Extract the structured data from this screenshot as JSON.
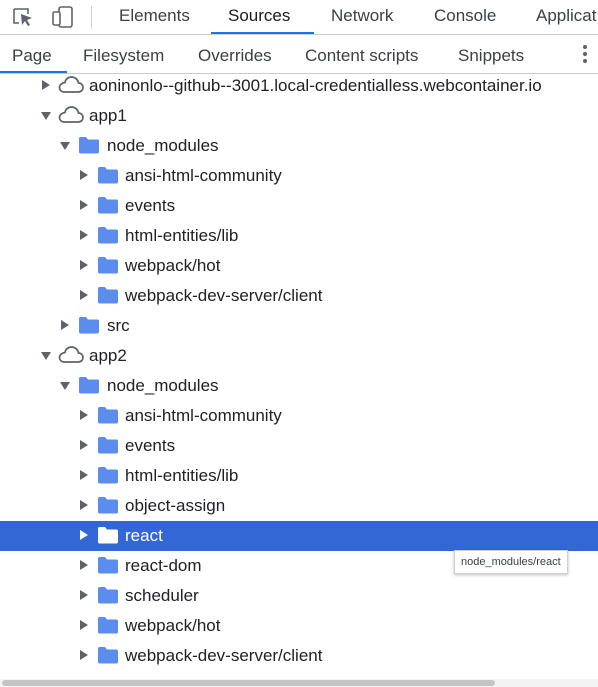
{
  "toolbar": {
    "inspect_icon": "inspect-element-icon",
    "device_icon": "device-toolbar-icon",
    "tabs": [
      "Elements",
      "Sources",
      "Network",
      "Console",
      "Applicat"
    ],
    "active_tab": "Sources"
  },
  "subtabs": {
    "items": [
      "Page",
      "Filesystem",
      "Overrides",
      "Content scripts",
      "Snippets"
    ],
    "active": "Page",
    "more_icon": "more-options-icon"
  },
  "tree": [
    {
      "label": "aoninonlo--github--3001.local-credentialless.webcontainer.io",
      "kind": "cloud",
      "expanded": false
    },
    {
      "label": "app1",
      "kind": "cloud",
      "expanded": true
    },
    {
      "label": "node_modules",
      "kind": "folder",
      "expanded": true
    },
    {
      "label": "ansi-html-community",
      "kind": "folder",
      "expanded": false
    },
    {
      "label": "events",
      "kind": "folder",
      "expanded": false
    },
    {
      "label": "html-entities/lib",
      "kind": "folder",
      "expanded": false
    },
    {
      "label": "webpack/hot",
      "kind": "folder",
      "expanded": false
    },
    {
      "label": "webpack-dev-server/client",
      "kind": "folder",
      "expanded": false
    },
    {
      "label": "src",
      "kind": "folder",
      "expanded": false
    },
    {
      "label": "app2",
      "kind": "cloud",
      "expanded": true
    },
    {
      "label": "node_modules",
      "kind": "folder",
      "expanded": true
    },
    {
      "label": "ansi-html-community",
      "kind": "folder",
      "expanded": false
    },
    {
      "label": "events",
      "kind": "folder",
      "expanded": false
    },
    {
      "label": "html-entities/lib",
      "kind": "folder",
      "expanded": false
    },
    {
      "label": "object-assign",
      "kind": "folder",
      "expanded": false
    },
    {
      "label": "react",
      "kind": "folder",
      "expanded": false,
      "selected": true
    },
    {
      "label": "react-dom",
      "kind": "folder",
      "expanded": false
    },
    {
      "label": "scheduler",
      "kind": "folder",
      "expanded": false
    },
    {
      "label": "webpack/hot",
      "kind": "folder",
      "expanded": false
    },
    {
      "label": "webpack-dev-server/client",
      "kind": "folder",
      "expanded": false
    }
  ],
  "tooltip": "node_modules/react",
  "colors": {
    "accent": "#1a73e8",
    "selection": "#3367d6",
    "folder": "#5b8def"
  }
}
